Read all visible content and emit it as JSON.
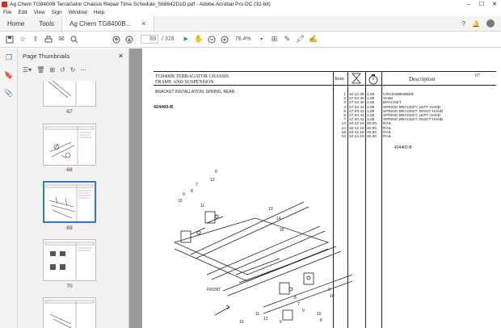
{
  "window": {
    "title": "Ag Chem TG8400B TerraGator Chassis Repair Time Schedule_568642D1D.pdf - Adobe Acrobat Pro DC (32-bit)",
    "controls": [
      "–",
      "☐",
      "✕"
    ]
  },
  "menu": [
    "File",
    "Edit",
    "View",
    "Sign",
    "Window",
    "Help"
  ],
  "tabs": {
    "home": "Home",
    "tools": "Tools",
    "doc": "Ag Chem TG8400B...",
    "close": "✕"
  },
  "toolbar": {
    "current_page": "69",
    "page_total": "/ 316",
    "zoom": "78.4%"
  },
  "panel": {
    "title": "Page Thumbnails",
    "close": "✕"
  },
  "thumbnails": [
    {
      "label": "67"
    },
    {
      "label": "68"
    },
    {
      "label": "69"
    },
    {
      "label": "70"
    }
  ],
  "document": {
    "header_line1": "TG8400B TERRAGATOR CHASSIS",
    "header_line2": "FRAME AND SUSPENSION",
    "col_item": "Item",
    "col_description": "Description",
    "page_number": "67",
    "section": "BRACKET INSTALLATION, SPRING, REAR",
    "figure_id": "424460-B",
    "figure_id_small": "424460-B",
    "parts": [
      {
        "item": "1",
        "code": "34 12 29",
        "time": "1,00",
        "desc": "CROSSMEMBER"
      },
      {
        "item": "2",
        "code": "27 03 39",
        "time": "1,00",
        "desc": "SHIM"
      },
      {
        "item": "3",
        "code": "27 03 40",
        "time": "1,00",
        "desc": "BRACKET"
      },
      {
        "item": "4",
        "code": "27 03 41",
        "time": "1,00",
        "desc": "SPRING BRACKET, LEFT HAND"
      },
      {
        "item": "5",
        "code": "27 03 41",
        "time": "1,00",
        "desc": "SPRING BRACKET, RIGHT HAND"
      },
      {
        "item": "6",
        "code": "27 03 41",
        "time": "1,00",
        "desc": "SPRING BRACKET, LEFT HAND"
      },
      {
        "item": "7",
        "code": "27 03 41",
        "time": "1,00",
        "desc": "SPRING BRACKET, RIGHT HAND"
      },
      {
        "item": "13",
        "code": "34 12 19",
        "time": "20,00",
        "desc": "RAIL"
      },
      {
        "item": "14",
        "code": "34 12 19",
        "time": "20,00",
        "desc": "RAIL"
      },
      {
        "item": "15",
        "code": "34 12 19",
        "time": "20,00",
        "desc": "RAIL"
      },
      {
        "item": "16",
        "code": "34 12 19",
        "time": "20,00",
        "desc": "RAIL"
      }
    ],
    "callouts": [
      "7",
      "8",
      "9",
      "10",
      "6",
      "12",
      "11",
      "13",
      "14",
      "15",
      "9",
      "10",
      "8",
      "9",
      "7",
      "10",
      "8",
      "11",
      "12",
      "9",
      "16",
      "FRONT"
    ]
  }
}
